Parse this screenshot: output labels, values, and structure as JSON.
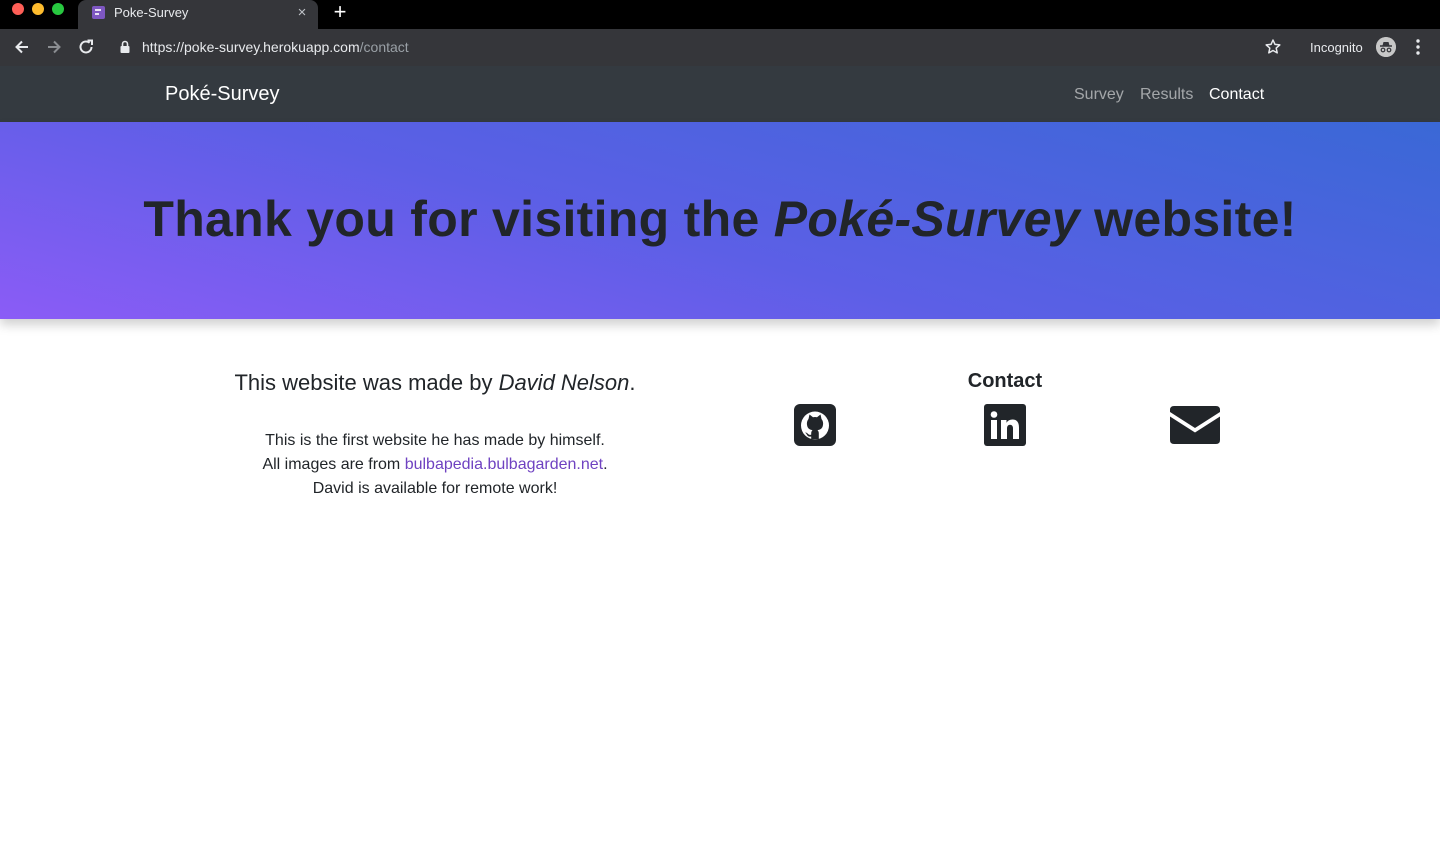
{
  "browser": {
    "tab_title": "Poke-Survey",
    "tab_close": "×",
    "new_tab": "+",
    "url_host": "https://poke-survey.herokuapp.com",
    "url_path": "/contact",
    "incognito_label": "Incognito"
  },
  "navbar": {
    "brand": "Poké-Survey",
    "links": [
      {
        "label": "Survey",
        "active": false
      },
      {
        "label": "Results",
        "active": false
      },
      {
        "label": "Contact",
        "active": true
      }
    ]
  },
  "hero": {
    "title_prefix": "Thank you for visiting the ",
    "title_emphasis": "Poké-Survey",
    "title_suffix": " website!"
  },
  "about": {
    "heading_prefix": "This website was made by ",
    "heading_name": "David Nelson",
    "heading_suffix": ".",
    "line1": "This is the first website he has made by himself.",
    "line2_prefix": "All images are from ",
    "line2_link": "bulbapedia.bulbagarden.net",
    "line2_suffix": ".",
    "line3": "David is available for remote work!"
  },
  "contact": {
    "heading": "Contact",
    "icons": [
      "github-icon",
      "linkedin-icon",
      "email-icon"
    ]
  },
  "colors": {
    "navbar_bg": "#343a40",
    "hero_gradient_start": "#8b5cf6",
    "hero_gradient_end": "#3a68d6",
    "link": "#6f42c1",
    "text": "#212529"
  }
}
